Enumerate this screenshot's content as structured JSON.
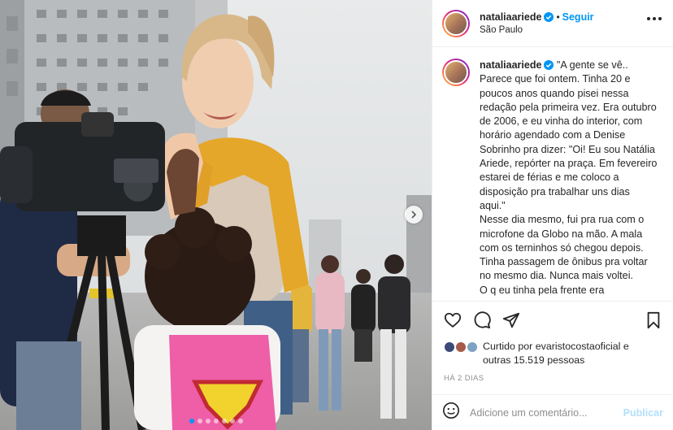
{
  "post": {
    "username": "nataliaariede",
    "follow_label": "Seguir",
    "separator": "•",
    "location": "São Paulo",
    "caption_user": "nataliaariede",
    "caption_text": " \"A gente se vê.. Parece que foi ontem. Tinha 20 e poucos anos quando pisei nessa redação pela primeira vez. Era outubro de 2006, e eu vinha do interior, com horário agendado com a Denise Sobrinho pra dizer: \"Oi! Eu sou Natália Ariede, repórter na praça. Em fevereiro estarei de férias e me coloco a disposição pra trabalhar uns dias aqui.\"\nNesse dia mesmo, fui pra rua com o microfone da Globo na mão. A mala com os terninhos só chegou depois. Tinha passagem de ônibus pra voltar no mesmo dia. Nunca mais voltei.\nO q eu tinha pela frente era",
    "likes_line1": "Curtido por evaristocostaoficial e",
    "likes_line2": "outras 15.519 pessoas",
    "date": "HÁ 2 DIAS",
    "comment_placeholder": "Adicione um comentário...",
    "publish_label": "Publicar"
  },
  "carousel": {
    "slide_count": 7,
    "active_index": 0
  },
  "icons": {
    "verified": "verified-badge-icon",
    "more": "more-options-icon",
    "like": "heart-icon",
    "comment": "comment-icon",
    "share": "paper-plane-icon",
    "save": "bookmark-icon",
    "emoji": "emoji-icon",
    "next": "chevron-right-icon"
  },
  "colors": {
    "accent": "#0095f6",
    "publish_disabled": "#b2dffc",
    "muted": "#8e8e8e",
    "text": "#262626"
  }
}
